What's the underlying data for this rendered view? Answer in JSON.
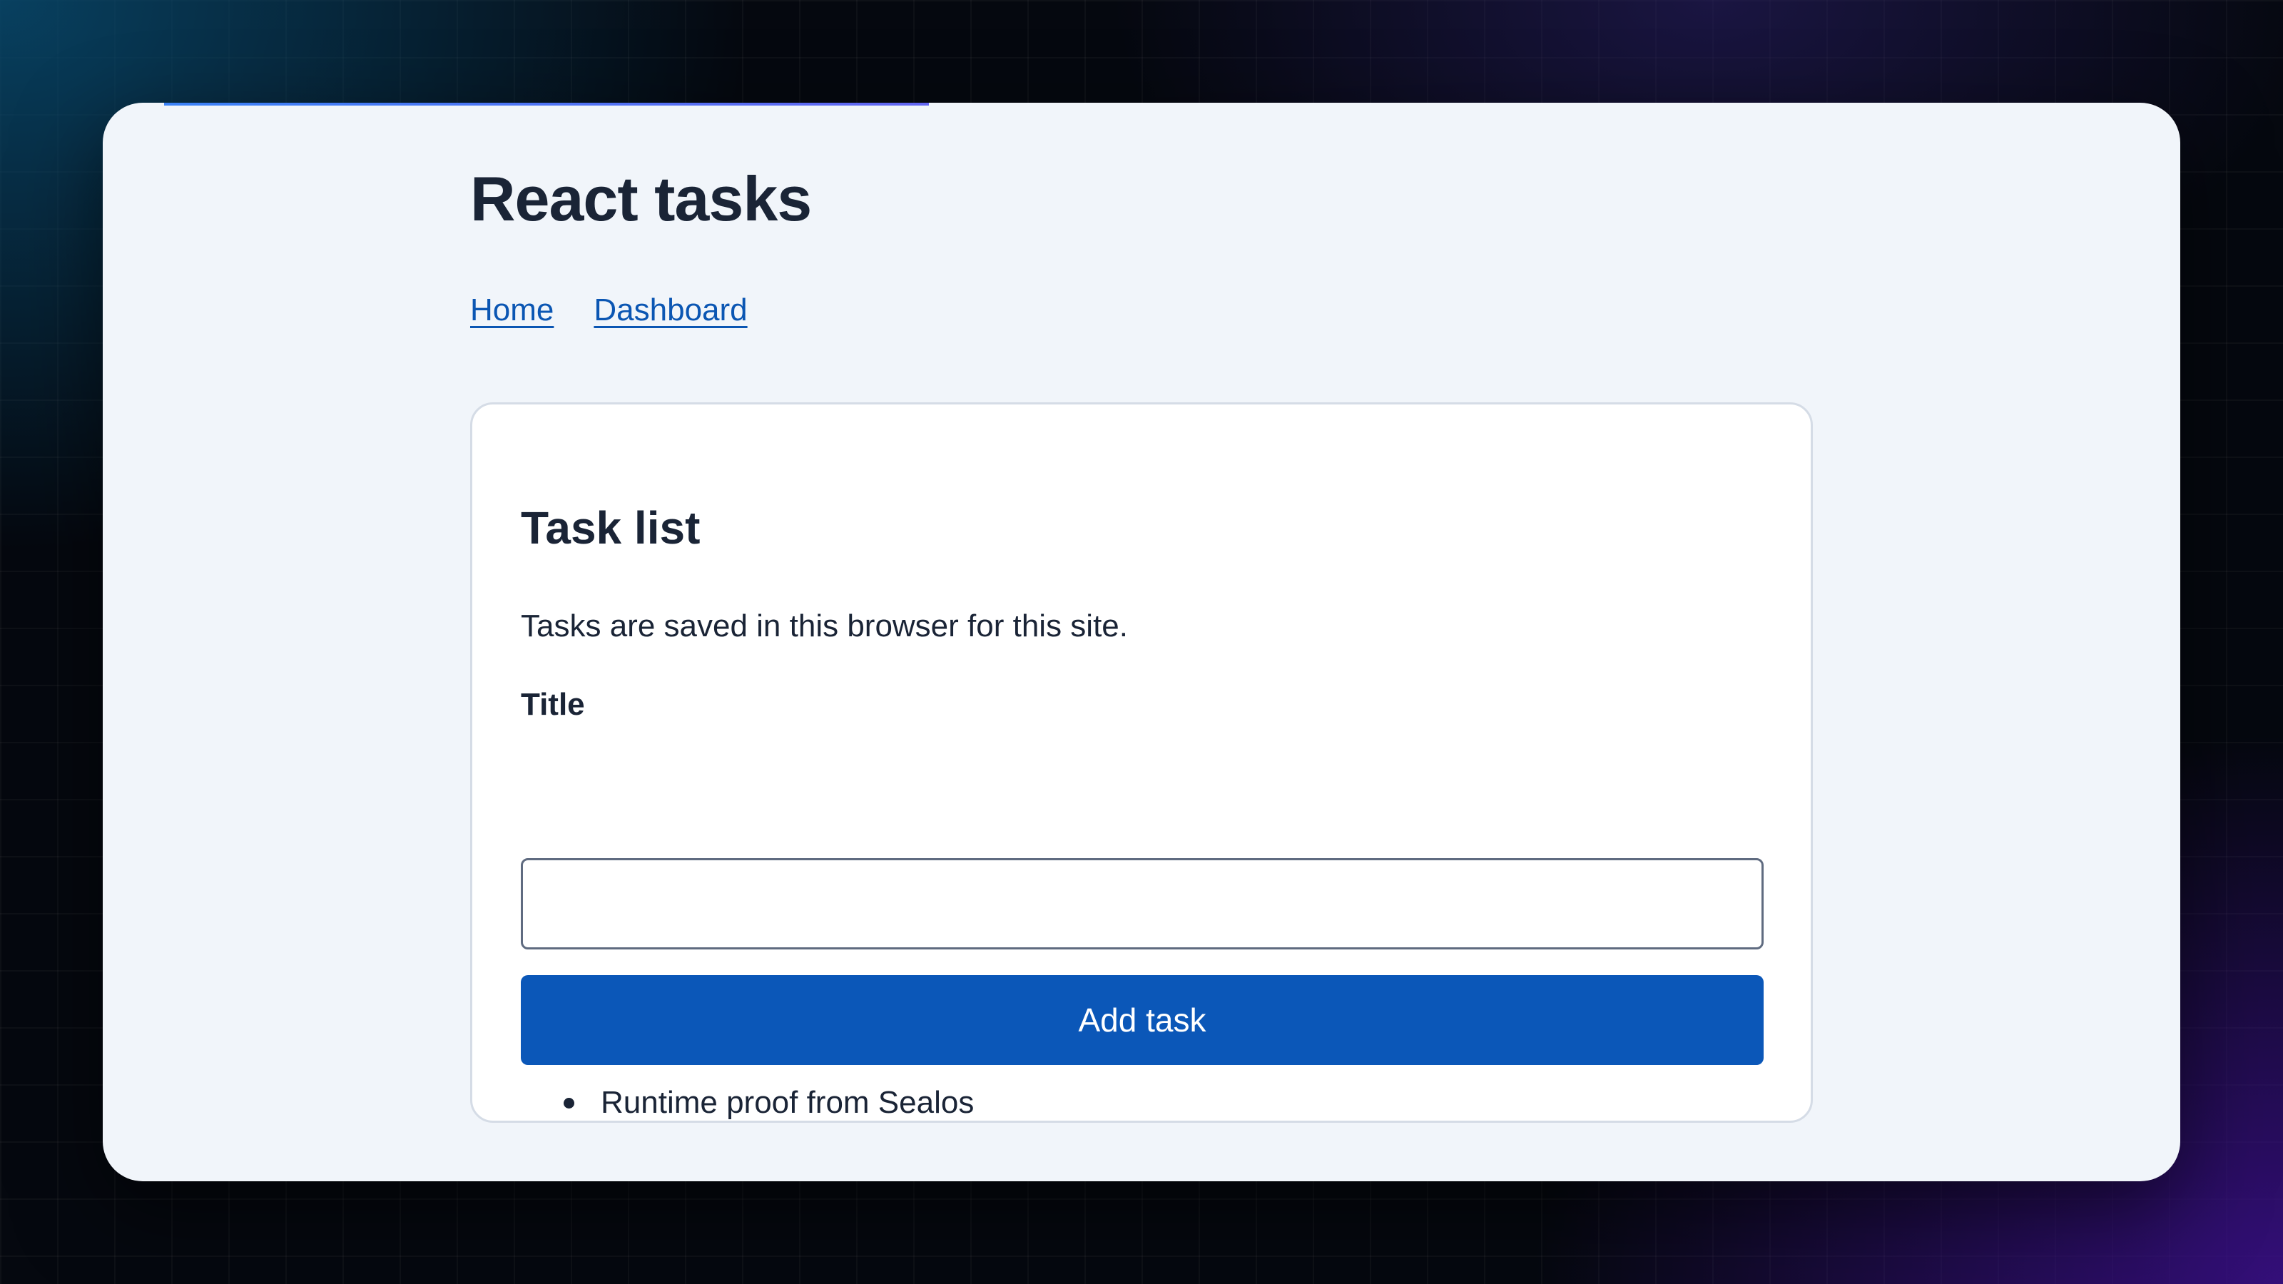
{
  "page": {
    "title": "React tasks"
  },
  "nav": {
    "items": [
      {
        "label": "Home"
      },
      {
        "label": "Dashboard"
      }
    ]
  },
  "card": {
    "title": "Task list",
    "description": "Tasks are saved in this browser for this site.",
    "field_label": "Title",
    "input_value": "",
    "button_label": "Add task"
  },
  "tasks": [
    {
      "text": "Runtime proof from Sealos"
    }
  ],
  "colors": {
    "accent": "#0b57b8",
    "link": "#0b56b3",
    "text": "#1a2436",
    "window_bg": "#f1f5fa",
    "card_bg": "#ffffff"
  }
}
